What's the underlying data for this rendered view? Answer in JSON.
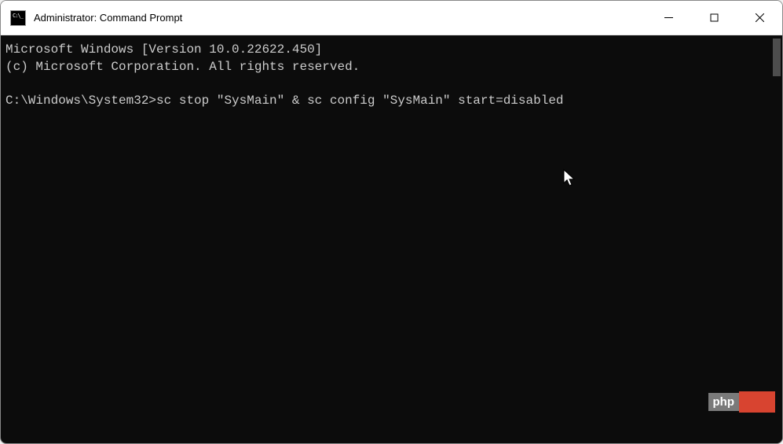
{
  "window": {
    "title": "Administrator: Command Prompt"
  },
  "terminal": {
    "line1": "Microsoft Windows [Version 10.0.22622.450]",
    "line2": "(c) Microsoft Corporation. All rights reserved.",
    "blank": "",
    "prompt": "C:\\Windows\\System32>",
    "command": "sc stop \"SysMain\" & sc config \"SysMain\" start=disabled"
  },
  "watermark": {
    "left": "php",
    "right": ""
  }
}
